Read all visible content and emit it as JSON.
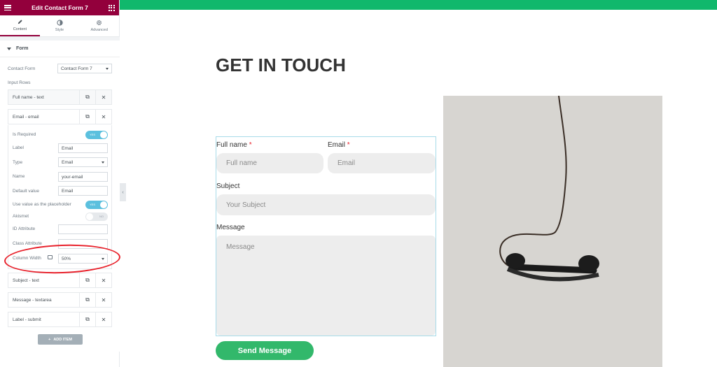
{
  "sidebar": {
    "title": "Edit Contact Form 7",
    "tabs": [
      {
        "label": "Content",
        "icon": "pencil-icon"
      },
      {
        "label": "Style",
        "icon": "half-circle-icon"
      },
      {
        "label": "Advanced",
        "icon": "gear-icon"
      }
    ],
    "section_title": "Form",
    "contact_form_label": "Contact Form",
    "contact_form_value": "Contact Form 7",
    "input_rows_label": "Input Rows",
    "rows": [
      {
        "label": "Full name - text"
      },
      {
        "label": "Email - email"
      },
      {
        "label": "Subject - text"
      },
      {
        "label": "Message - textarea"
      },
      {
        "label": "Label - submit"
      }
    ],
    "email_settings": {
      "is_required_label": "Is Required",
      "is_required_toggle": "YES",
      "label_label": "Label",
      "label_value": "Email",
      "type_label": "Type",
      "type_value": "Email",
      "name_label": "Name",
      "name_value": "your-email",
      "default_label": "Default value",
      "default_value": "Email",
      "placeholder_label": "Use value as the placeholder",
      "placeholder_toggle": "YES",
      "akismet_label": "Akismet",
      "akismet_toggle": "NO",
      "id_label": "ID Attribute",
      "id_value": "",
      "class_label": "Class Attribute",
      "class_value": "",
      "width_label": "Column Width",
      "width_value": "50%"
    },
    "add_item_label": "ADD ITEM"
  },
  "preview": {
    "heading": "GET IN TOUCH",
    "fullname_label": "Full name",
    "fullname_placeholder": "Full name",
    "email_label": "Email",
    "email_placeholder": "Email",
    "required_mark": "*",
    "subject_label": "Subject",
    "subject_placeholder": "Your Subject",
    "message_label": "Message",
    "message_placeholder": "Message",
    "send_label": "Send Message"
  },
  "colors": {
    "sidebar_header": "#93003c",
    "top_bar": "#10b86c",
    "send_button": "#32b86b",
    "annotation": "#e8202a"
  }
}
